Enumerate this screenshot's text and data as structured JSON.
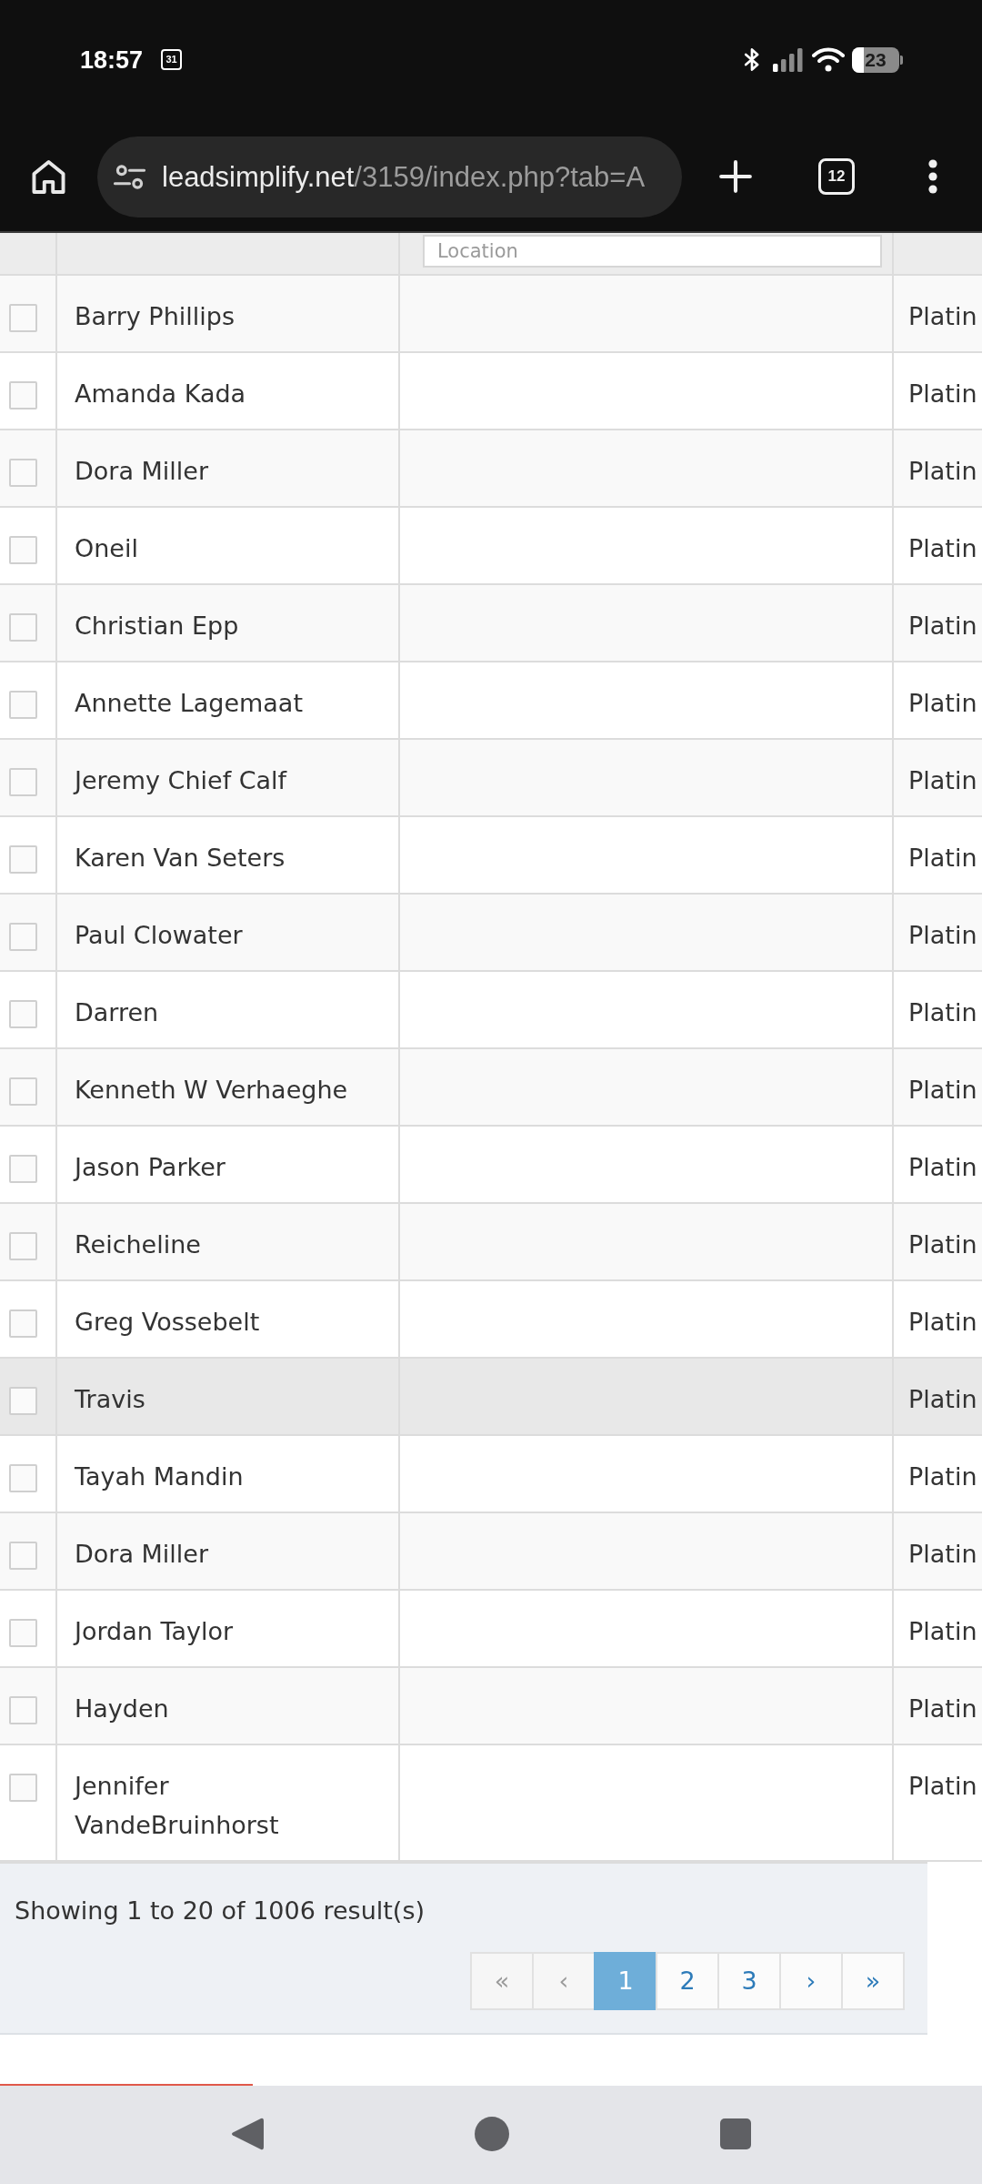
{
  "status_bar": {
    "time": "18:57",
    "calendar_day": "31",
    "battery": "23"
  },
  "browser": {
    "url_domain": "leadsimplify.net",
    "url_path": "/3159/index.php?tab=A",
    "tab_count": "12"
  },
  "table": {
    "location_filter": {
      "placeholder": "Location"
    },
    "rows": [
      {
        "column_2": "Barry Phillips",
        "column_4": "Platin",
        "checked": false,
        "highlighted": false
      },
      {
        "column_2": "Amanda Kada",
        "column_4": "Platin",
        "checked": false,
        "highlighted": false
      },
      {
        "column_2": "Dora Miller",
        "column_4": "Platin",
        "checked": false,
        "highlighted": false
      },
      {
        "column_2": "Oneil",
        "column_4": "Platin",
        "checked": false,
        "highlighted": false
      },
      {
        "column_2": "Christian Epp",
        "column_4": "Platin",
        "checked": false,
        "highlighted": false
      },
      {
        "column_2": "Annette Lagemaat",
        "column_4": "Platin",
        "checked": false,
        "highlighted": false
      },
      {
        "column_2": "Jeremy Chief Calf",
        "column_4": "Platin",
        "checked": false,
        "highlighted": false
      },
      {
        "column_2": "Karen Van Seters",
        "column_4": "Platin",
        "checked": false,
        "highlighted": false
      },
      {
        "column_2": "Paul Clowater",
        "column_4": "Platin",
        "checked": false,
        "highlighted": false
      },
      {
        "column_2": "Darren",
        "column_4": "Platin",
        "checked": false,
        "highlighted": false
      },
      {
        "column_2": "Kenneth W Verhaeghe",
        "column_4": "Platin",
        "checked": false,
        "highlighted": false
      },
      {
        "column_2": "Jason Parker",
        "column_4": "Platin",
        "checked": false,
        "highlighted": false
      },
      {
        "column_2": "Reicheline",
        "column_4": "Platin",
        "checked": false,
        "highlighted": false
      },
      {
        "column_2": "Greg Vossebelt",
        "column_4": "Platin",
        "checked": false,
        "highlighted": false
      },
      {
        "column_2": "Travis",
        "column_4": "Platin",
        "checked": false,
        "highlighted": true
      },
      {
        "column_2": "Tayah Mandin",
        "column_4": "Platin",
        "checked": false,
        "highlighted": false
      },
      {
        "column_2": "Dora Miller",
        "column_4": "Platin",
        "checked": false,
        "highlighted": false
      },
      {
        "column_2": "Jordan Taylor",
        "column_4": "Platin",
        "checked": false,
        "highlighted": false
      },
      {
        "column_2": "Hayden",
        "column_4": "Platin",
        "checked": false,
        "highlighted": false
      },
      {
        "column_2": "Jennifer VandeBruinhorst",
        "column_4": "Platin",
        "checked": false,
        "highlighted": false
      }
    ]
  },
  "footer": {
    "summary": "Showing 1 to 20 of 1006 result(s)",
    "pagination": [
      {
        "label": "«",
        "selected": false,
        "disabled": true
      },
      {
        "label": "‹",
        "selected": false,
        "disabled": true
      },
      {
        "label": "1",
        "selected": true,
        "disabled": false
      },
      {
        "label": "2",
        "selected": false,
        "disabled": false
      },
      {
        "label": "3",
        "selected": false,
        "disabled": false
      },
      {
        "label": "›",
        "selected": false,
        "disabled": false
      },
      {
        "label": "»",
        "selected": false,
        "disabled": false
      }
    ]
  }
}
